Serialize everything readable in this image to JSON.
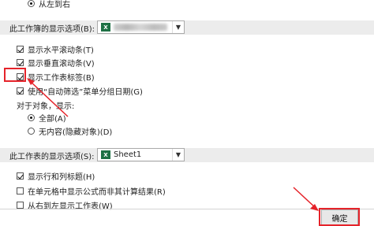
{
  "colors": {
    "highlight": "#e5232a",
    "section_bg": "#ececec",
    "excel_green": "#1e7145"
  },
  "top_option": {
    "label": "从左到右"
  },
  "workbook_section": {
    "title": "此工作簿的显示选项(B):",
    "combo_icon": "excel-workbook-icon"
  },
  "workbook_options": [
    {
      "label": "显示水平滚动条(T)",
      "checked": true
    },
    {
      "label": "显示垂直滚动条(V)",
      "checked": true
    },
    {
      "label": "显示工作表标签(B)",
      "checked": true
    },
    {
      "label": "使用“自动筛选”菜单分组日期(G)",
      "checked": true
    }
  ],
  "objects_label": "对于对象，显示:",
  "object_radios": [
    {
      "label": "全部(A)",
      "checked": true
    },
    {
      "label": "无内容(隐藏对象)(D)",
      "checked": false
    }
  ],
  "worksheet_section": {
    "title": "此工作表的显示选项(S):",
    "combo_value": "Sheet1",
    "combo_icon": "excel-sheet-icon"
  },
  "worksheet_options": [
    {
      "label": "显示行和列标题(H)",
      "checked": true
    },
    {
      "label": "在单元格中显示公式而非其计算结果(R)",
      "checked": false
    },
    {
      "label": "从右到左显示工作表(W)",
      "checked": false
    }
  ],
  "ok_button": {
    "label": "确定"
  }
}
